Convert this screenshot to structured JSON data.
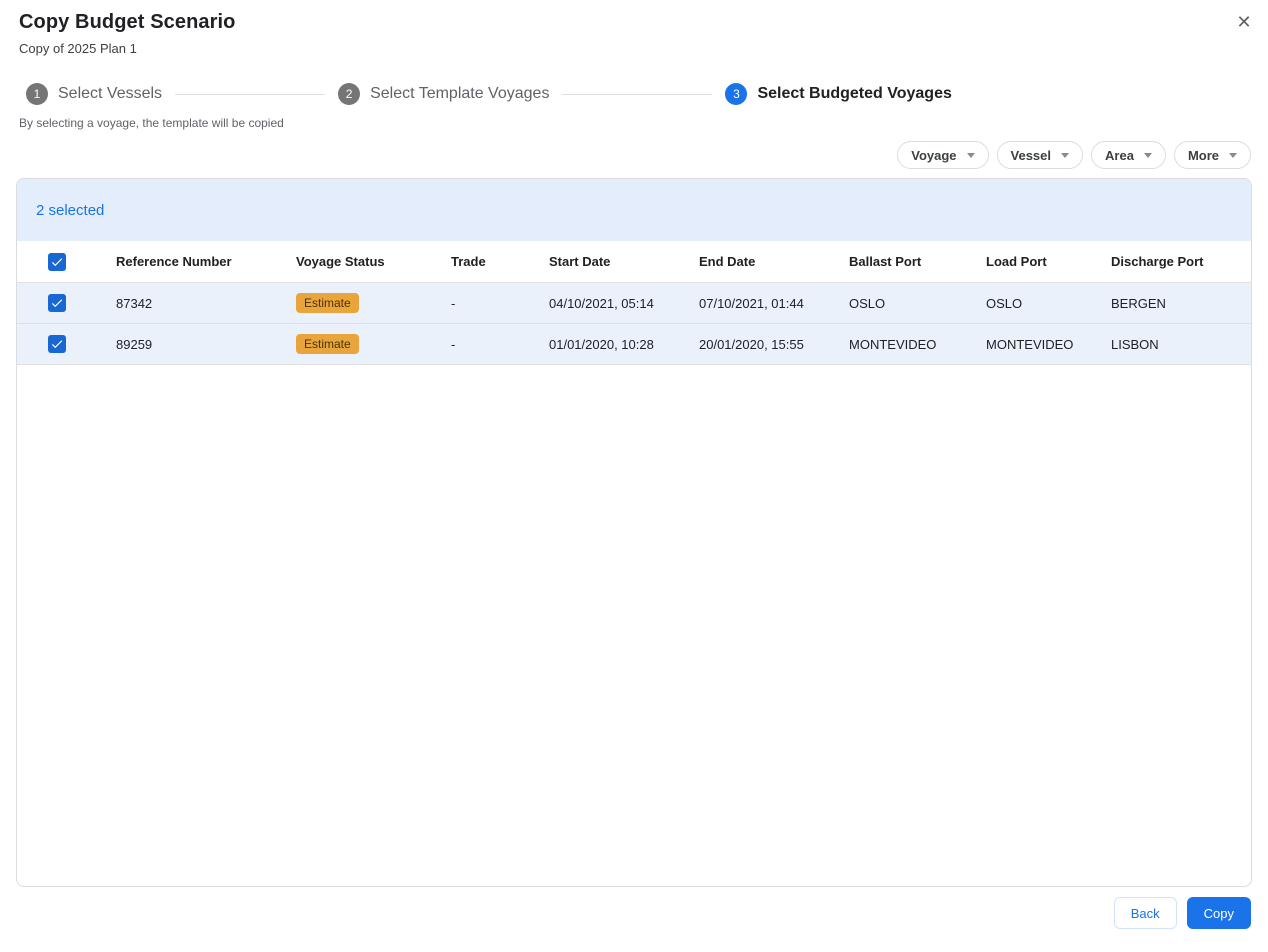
{
  "dialog": {
    "title": "Copy Budget Scenario",
    "subtitle": "Copy of 2025 Plan 1",
    "close_icon": "✕",
    "caption": "By selecting a voyage, the template will be copied"
  },
  "stepper": {
    "steps": [
      {
        "number": "1",
        "label": "Select Vessels",
        "state": "inactive"
      },
      {
        "number": "2",
        "label": "Select Template Voyages",
        "state": "inactive"
      },
      {
        "number": "3",
        "label": "Select Budgeted Voyages",
        "state": "active"
      }
    ]
  },
  "filters": [
    {
      "label": "Voyage"
    },
    {
      "label": "Vessel"
    },
    {
      "label": "Area"
    },
    {
      "label": "More"
    }
  ],
  "table": {
    "selection_summary": "2 selected",
    "columns": [
      "Reference Number",
      "Voyage Status",
      "Trade",
      "Start Date",
      "End Date",
      "Ballast Port",
      "Load Port",
      "Discharge Port"
    ],
    "rows": [
      {
        "selected": true,
        "reference_number": "87342",
        "voyage_status": "Estimate",
        "trade": "-",
        "start_date": "04/10/2021, 05:14",
        "end_date": "07/10/2021, 01:44",
        "ballast_port": "OSLO",
        "load_port": "OSLO",
        "discharge_port": "BERGEN"
      },
      {
        "selected": true,
        "reference_number": "89259",
        "voyage_status": "Estimate",
        "trade": "-",
        "start_date": "01/01/2020, 10:28",
        "end_date": "20/01/2020, 15:55",
        "ballast_port": "MONTEVIDEO",
        "load_port": "MONTEVIDEO",
        "discharge_port": "LISBON"
      }
    ]
  },
  "footer": {
    "back_label": "Back",
    "copy_label": "Copy"
  },
  "colors": {
    "accent": "#1a73e8",
    "checkbox": "#1967d2",
    "badge_bg": "#e9a53c",
    "selection_band_bg": "#e4edfb",
    "selected_row_bg": "#eaf1fb",
    "inactive_step": "#757575"
  }
}
